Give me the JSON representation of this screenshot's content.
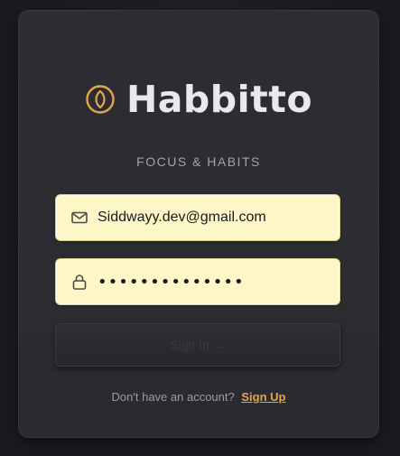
{
  "brand": {
    "name": "Habbitto",
    "tagline": "FOCUS & HABITS",
    "logo_icon": "leaf-ring-icon",
    "accent_color": "#e0a74a"
  },
  "form": {
    "email": {
      "value": "Siddwayy.dev@gmail.com",
      "icon": "mail-icon"
    },
    "password": {
      "value": "••••••••••••••",
      "icon": "lock-icon"
    },
    "submit_label": "Sign In →"
  },
  "footer": {
    "prompt": "Don't have an account?",
    "signup_label": "Sign Up"
  },
  "colors": {
    "background": "#1c1b20",
    "card": "#2c2b31",
    "field_fill": "#fdf7c8",
    "link": "#e0a74a"
  }
}
